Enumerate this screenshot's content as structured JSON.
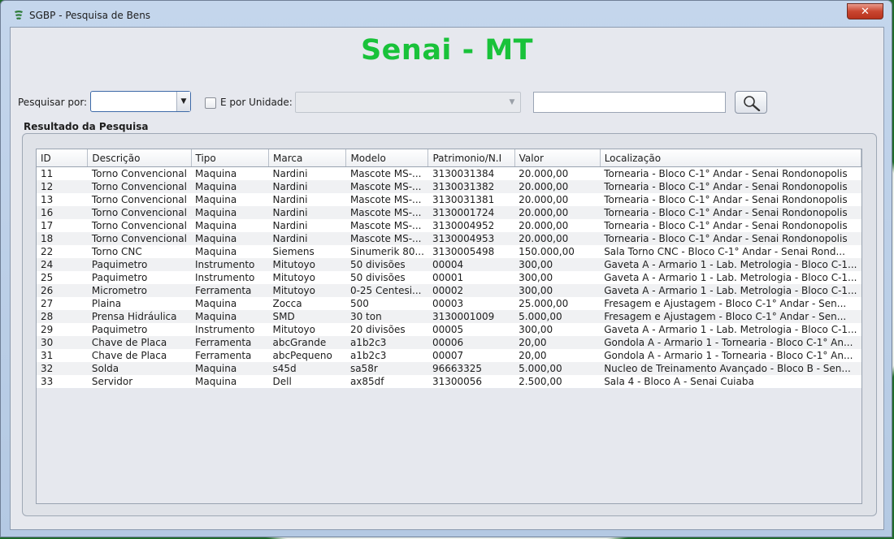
{
  "window": {
    "title": "SGBP - Pesquisa de Bens",
    "close_label": "✕"
  },
  "brand": "Senai - MT",
  "search": {
    "search_by_label": "Pesquisar por:",
    "search_by_value": "",
    "unit_checkbox_label": "E por Unidade:",
    "unit_value": "",
    "query_value": ""
  },
  "results": {
    "title": "Resultado da Pesquisa",
    "columns": [
      "ID",
      "Descrição",
      "Tipo",
      "Marca",
      "Modelo",
      "Patrimonio/N.I",
      "Valor",
      "Localização"
    ],
    "rows": [
      [
        "11",
        "Torno Convencional",
        "Maquina",
        "Nardini",
        "Mascote MS-...",
        "3130031384",
        "20.000,00",
        "Tornearia - Bloco C-1° Andar - Senai Rondonopolis"
      ],
      [
        "12",
        "Torno Convencional",
        "Maquina",
        "Nardini",
        "Mascote MS-...",
        "3130031382",
        "20.000,00",
        "Tornearia - Bloco C-1° Andar - Senai Rondonopolis"
      ],
      [
        "13",
        "Torno Convencional",
        "Maquina",
        "Nardini",
        "Mascote MS-...",
        "3130031381",
        "20.000,00",
        "Tornearia - Bloco C-1° Andar - Senai Rondonopolis"
      ],
      [
        "16",
        "Torno Convencional",
        "Maquina",
        "Nardini",
        "Mascote MS-...",
        "3130001724",
        "20.000,00",
        "Tornearia - Bloco C-1° Andar - Senai Rondonopolis"
      ],
      [
        "17",
        "Torno Convencional",
        "Maquina",
        "Nardini",
        "Mascote MS-...",
        "3130004952",
        "20.000,00",
        "Tornearia - Bloco C-1° Andar - Senai Rondonopolis"
      ],
      [
        "18",
        "Torno Convencional",
        "Maquina",
        "Nardini",
        "Mascote MS-...",
        "3130004953",
        "20.000,00",
        "Tornearia - Bloco C-1° Andar - Senai Rondonopolis"
      ],
      [
        "22",
        "Torno CNC",
        "Maquina",
        "Siemens",
        "Sinumerik 80...",
        "3130005498",
        "150.000,00",
        "Sala Torno CNC - Bloco C-1° Andar - Senai Rond..."
      ],
      [
        "24",
        "Paquimetro",
        "Instrumento",
        "Mitutoyo",
        "50 divisões",
        "00004",
        "300,00",
        "Gaveta A - Armario 1 - Lab. Metrologia - Bloco C-1..."
      ],
      [
        "25",
        "Paquimetro",
        "Instrumento",
        "Mitutoyo",
        "50 divisões",
        "00001",
        "300,00",
        "Gaveta A - Armario 1 - Lab. Metrologia - Bloco C-1..."
      ],
      [
        "26",
        "Micrometro",
        "Ferramenta",
        "Mitutoyo",
        "0-25 Centesi...",
        "00002",
        "300,00",
        "Gaveta A - Armario 1 - Lab. Metrologia - Bloco C-1..."
      ],
      [
        "27",
        "Plaina",
        "Maquina",
        "Zocca",
        "500",
        "00003",
        "25.000,00",
        "Fresagem  e Ajustagem - Bloco C-1° Andar - Sen..."
      ],
      [
        "28",
        "Prensa Hidráulica",
        "Maquina",
        "SMD",
        "30 ton",
        "3130001009",
        "5.000,00",
        "Fresagem  e Ajustagem - Bloco C-1° Andar - Sen..."
      ],
      [
        "29",
        "Paquimetro",
        "Instrumento",
        "Mitutoyo",
        "20 divisões",
        "00005",
        "300,00",
        "Gaveta A - Armario 1 - Lab. Metrologia - Bloco C-1..."
      ],
      [
        "30",
        "Chave de Placa",
        "Ferramenta",
        "abcGrande",
        "a1b2c3",
        "00006",
        "20,00",
        "Gondola A - Armario 1 - Tornearia - Bloco C-1° An..."
      ],
      [
        "31",
        "Chave de Placa",
        "Ferramenta",
        "abcPequeno",
        "a1b2c3",
        "00007",
        "20,00",
        "Gondola A - Armario 1 - Tornearia - Bloco C-1° An..."
      ],
      [
        "32",
        "Solda",
        "Maquina",
        "s45d",
        "sa58r",
        "96663325",
        "5.000,00",
        "Nucleo de Treinamento Avançado - Bloco B - Sen..."
      ],
      [
        "33",
        "Servidor",
        "Maquina",
        "Dell",
        "ax85df",
        "31300056",
        "2.500,00",
        "Sala 4 - Bloco A - Senai Cuiaba"
      ]
    ]
  },
  "colors": {
    "brand": "#19c23a",
    "titlebar": "#c4d6ec",
    "close_button": "#c9462f"
  }
}
